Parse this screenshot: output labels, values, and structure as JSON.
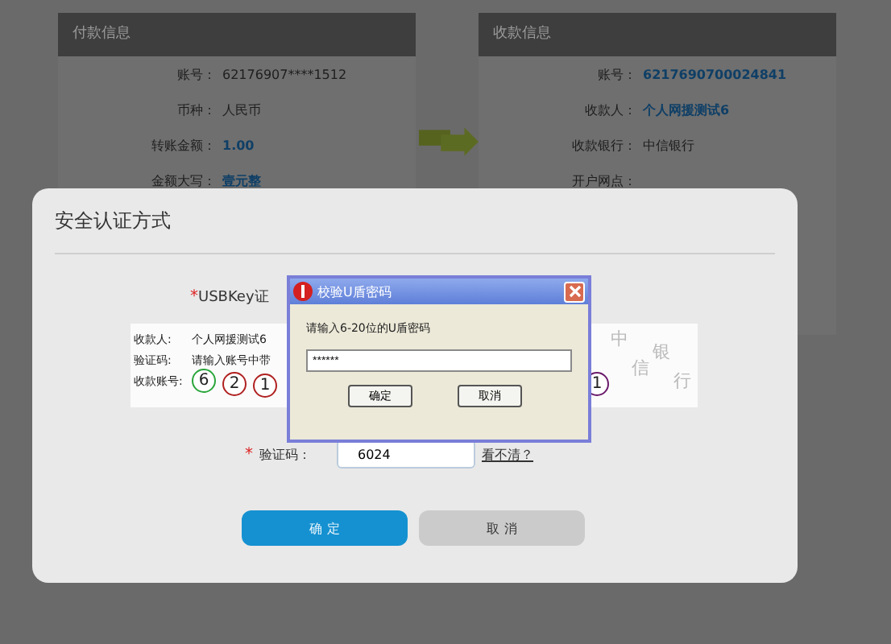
{
  "payer_panel": {
    "title": "付款信息",
    "fields": [
      {
        "label": "账号：",
        "value": "62176907****1512",
        "highlight": false
      },
      {
        "label": "币种：",
        "value": "人民币",
        "highlight": false
      },
      {
        "label": "转账金额：",
        "value": "1.00",
        "highlight": true
      },
      {
        "label": "金额大写：",
        "value": "壹元整",
        "highlight": true
      }
    ]
  },
  "payee_panel": {
    "title": "收款信息",
    "fields": [
      {
        "label": "账号：",
        "value": "6217690700024841",
        "highlight": true
      },
      {
        "label": "收款人：",
        "value": "个人网援测试6",
        "highlight": true
      },
      {
        "label": "收款银行：",
        "value": "中信银行",
        "highlight": false
      },
      {
        "label": "开户网点："
      }
    ]
  },
  "modal": {
    "title": "安全认证方式",
    "required_mark": "*",
    "usbkey_label": "USBKey证",
    "captcha": {
      "lines": [
        {
          "label": "收款人:",
          "value": "个人网援测试6"
        },
        {
          "label": "验证码:",
          "value": "请输入账号中带"
        }
      ],
      "account_label": "收款账号:",
      "digits": [
        {
          "text": "6",
          "color": "#2aa53a"
        },
        {
          "text": "2",
          "color": "#b02020"
        },
        {
          "text": "1",
          "color": "#b02020"
        }
      ],
      "right_digit": {
        "text": "1",
        "color": "#6a1a6a"
      },
      "noise": [
        "中",
        "信",
        "银",
        "行"
      ]
    },
    "code_label": "验证码：",
    "code_value": "6024",
    "refresh_link": "看不清？",
    "buttons": [
      {
        "label": "确 定",
        "kind": "primary"
      },
      {
        "label": "取 消",
        "kind": "secondary"
      }
    ]
  },
  "pin_dialog": {
    "title": "校验U盾密码",
    "prompt": "请输入6-20位的U盾密码",
    "value": "******",
    "buttons": [
      "确定",
      "取消"
    ]
  }
}
